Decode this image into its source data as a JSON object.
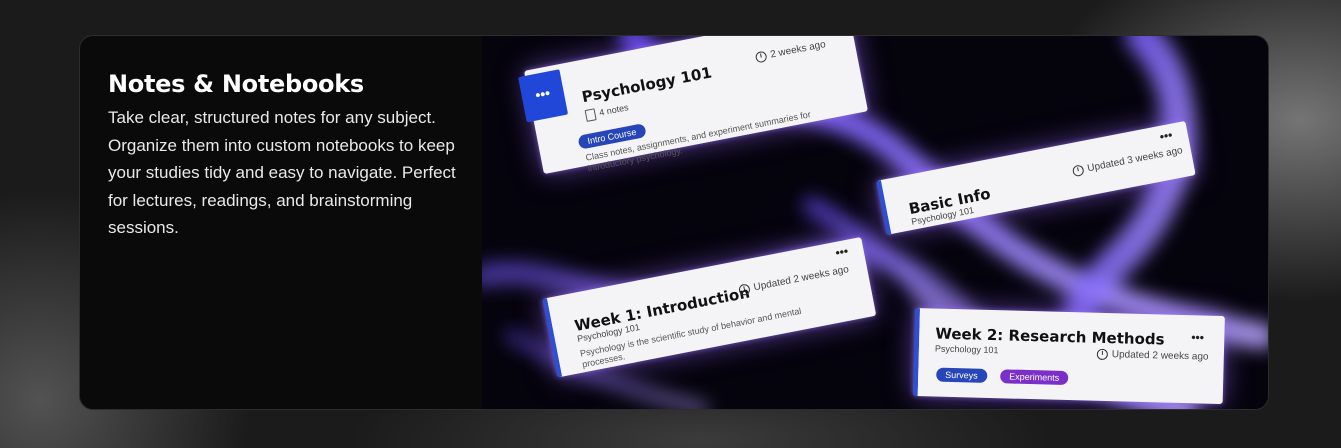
{
  "feature": {
    "title": "Notes & Notebooks",
    "description": "Take clear, structured notes for any subject. Organize them into custom notebooks to keep your studies tidy and easy to navigate. Perfect for lectures, readings, and brainstorming sessions."
  },
  "notebook_card": {
    "name": "Psychology 101",
    "count": "4 notes",
    "time": "2 weeks ago",
    "tag": "Intro Course",
    "body": "Class notes, assignments, and experiment summaries for introductory psychology.",
    "menu": "•••",
    "icon_label": "•••"
  },
  "notes": [
    {
      "name": "Basic Info",
      "notebook": "Psychology 101",
      "time": "Updated 3 weeks ago",
      "menu": "•••"
    },
    {
      "name": "Week 1: Introduction",
      "notebook": "Psychology 101",
      "time": "Updated 2 weeks ago",
      "body": "Psychology is the scientific study of behavior and mental processes.",
      "menu": "•••"
    },
    {
      "name": "Week 2: Research Methods",
      "notebook": "Psychology 101",
      "time": "Updated 2 weeks ago",
      "tags": [
        "Surveys",
        "Experiments"
      ],
      "menu": "•••"
    }
  ],
  "colors": {
    "accent_blue": "#2047d8",
    "tag_purple": "#7b2fc9",
    "glow": "#8a6bff"
  }
}
